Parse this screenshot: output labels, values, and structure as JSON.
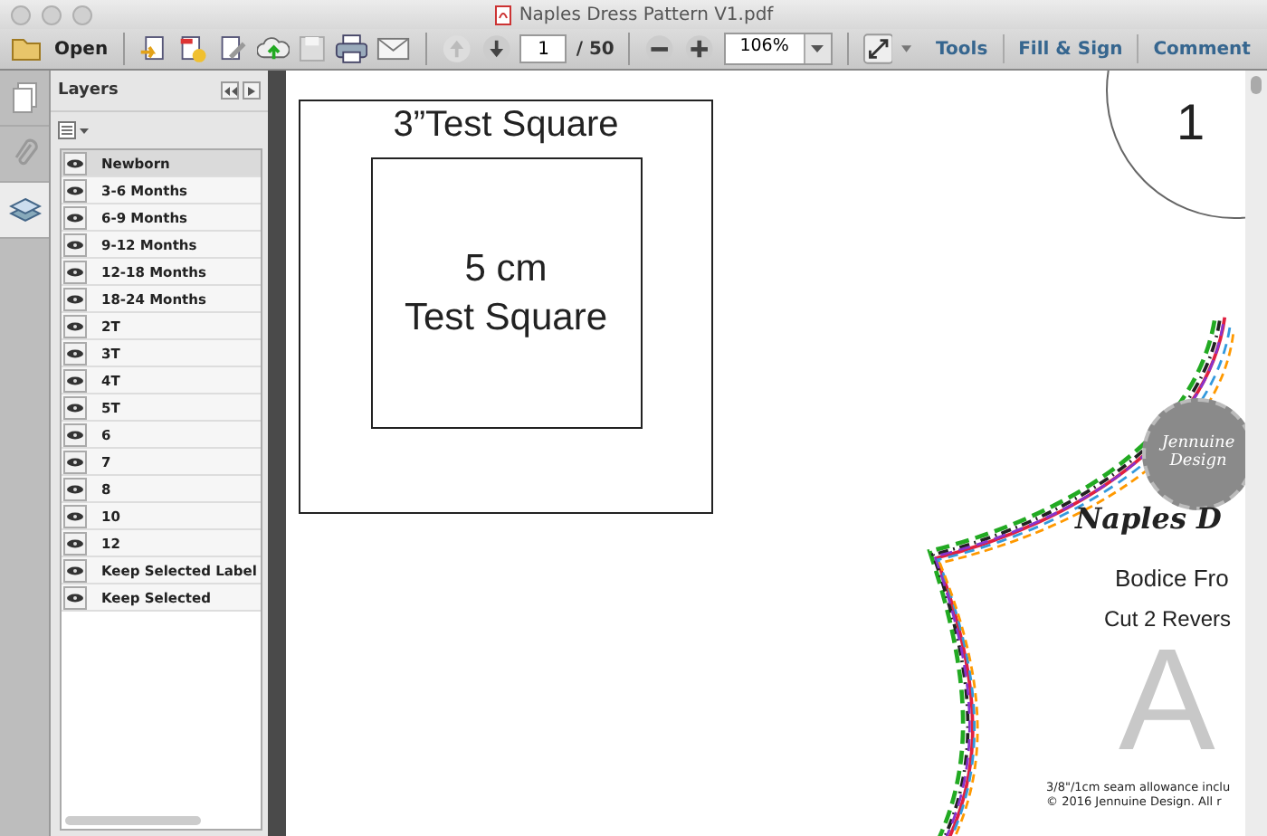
{
  "window": {
    "title": "Naples Dress Pattern V1.pdf"
  },
  "toolbar": {
    "open_label": "Open",
    "page_number": "1",
    "page_total": "/ 50",
    "zoom": "106%",
    "links": [
      "Tools",
      "Fill & Sign",
      "Comment"
    ]
  },
  "side_tabs": [
    {
      "kind": "pages",
      "selected": false
    },
    {
      "kind": "attachments",
      "selected": false
    },
    {
      "kind": "layers",
      "selected": true
    }
  ],
  "layers": {
    "title": "Layers",
    "items": [
      {
        "label": "Newborn",
        "visible": true,
        "selected": true
      },
      {
        "label": "3-6 Months",
        "visible": true,
        "selected": false
      },
      {
        "label": "6-9 Months",
        "visible": true,
        "selected": false
      },
      {
        "label": "9-12 Months",
        "visible": true,
        "selected": false
      },
      {
        "label": "12-18 Months",
        "visible": true,
        "selected": false
      },
      {
        "label": "18-24 Months",
        "visible": true,
        "selected": false
      },
      {
        "label": "2T",
        "visible": true,
        "selected": false
      },
      {
        "label": "3T",
        "visible": true,
        "selected": false
      },
      {
        "label": "4T",
        "visible": true,
        "selected": false
      },
      {
        "label": "5T",
        "visible": true,
        "selected": false
      },
      {
        "label": "6",
        "visible": true,
        "selected": false
      },
      {
        "label": "7",
        "visible": true,
        "selected": false
      },
      {
        "label": "8",
        "visible": true,
        "selected": false
      },
      {
        "label": "10",
        "visible": true,
        "selected": false
      },
      {
        "label": "12",
        "visible": true,
        "selected": false
      },
      {
        "label": "Keep Selected Label",
        "visible": true,
        "selected": false
      },
      {
        "label": "Keep Selected",
        "visible": true,
        "selected": false
      }
    ]
  },
  "page": {
    "outer_square_label": "3”Test Square",
    "inner_square_label": [
      "5 cm",
      "Test Square"
    ],
    "piece_number": "1",
    "logo": [
      "Jennuine",
      "Design"
    ],
    "pattern_name": "Naples D",
    "piece_name": "Bodice Fro",
    "cut_instruction": "Cut 2 Revers",
    "piece_letter": "A",
    "notes": [
      "3/8\"/1cm seam allowance inclu",
      "© 2016 Jennuine Design.  All r"
    ]
  }
}
